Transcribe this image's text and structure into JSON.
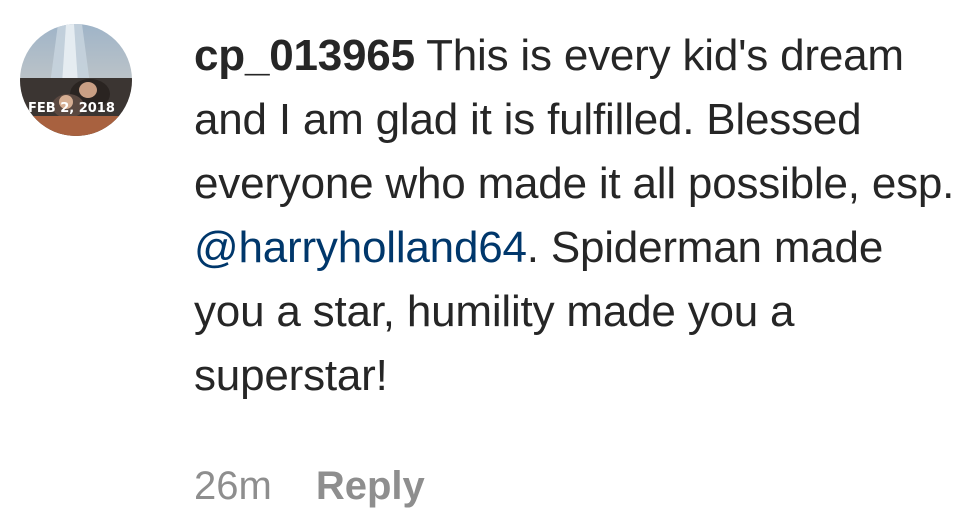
{
  "comment": {
    "username": "cp_013965",
    "text_before_mention": " This is every kid's dream and I am glad it is fulfilled. Blessed everyone who made it all possible, esp. ",
    "mention": "@harryholland64",
    "text_after_mention": ". Spiderman made you a star, humility made you a superstar!",
    "avatar_stamp": "FEB 2, 2018"
  },
  "footer": {
    "timestamp": "26m",
    "reply_label": "Reply"
  },
  "colors": {
    "text": "#262626",
    "mention": "#00376b",
    "meta": "#8e8e8e"
  }
}
